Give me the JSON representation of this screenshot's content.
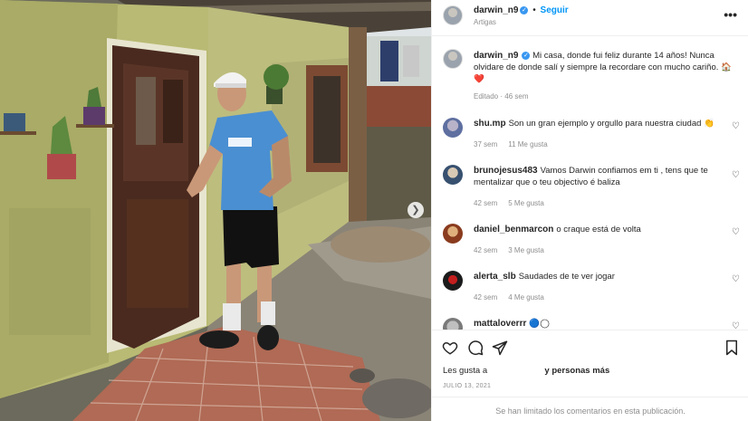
{
  "post_header": {
    "username": "darwin_n9",
    "separator": "•",
    "follow_label": "Seguir",
    "location": "Artigas",
    "more_icon": "more-options-icon"
  },
  "caption": {
    "username": "darwin_n9",
    "text": "Mi casa, donde fui feliz durante 14 años! Nunca olvidare de donde salí y siempre la recordare con mucho cariño. 🏠❤️",
    "meta": "Editado · 46 sem"
  },
  "comments": [
    {
      "username": "shu.mp",
      "text": "Son un gran ejemplo y orgullo para nuestra ciudad 👏",
      "age": "37 sem",
      "likes": "11 Me gusta"
    },
    {
      "username": "brunojesus483",
      "text": "Vamos Darwin confiamos em ti , tens que te mentalizar que o teu objectivo é baliza",
      "age": "42 sem",
      "likes": "5 Me gusta"
    },
    {
      "username": "daniel_benmarcon",
      "text": "o craque está de volta",
      "age": "42 sem",
      "likes": "3 Me gusta"
    },
    {
      "username": "alerta_slb",
      "text": "Saudades de te ver jogar",
      "age": "42 sem",
      "likes": "4 Me gusta"
    },
    {
      "username": "mattaloverrr",
      "text": "🔵◯",
      "age": "",
      "likes": ""
    }
  ],
  "actions": {
    "like_icon": "heart-icon",
    "comment_icon": "comment-icon",
    "share_icon": "share-icon",
    "save_icon": "bookmark-icon"
  },
  "likes": {
    "prefix": "Les gusta a",
    "suffix": "y personas más"
  },
  "post_date": "JULIO 13, 2021",
  "comments_limited": "Se han limitado los comentarios en esta publicación.",
  "colors": {
    "accent": "#0095f6",
    "verified": "#3897f0",
    "meta_gray": "#8e8e8e"
  }
}
